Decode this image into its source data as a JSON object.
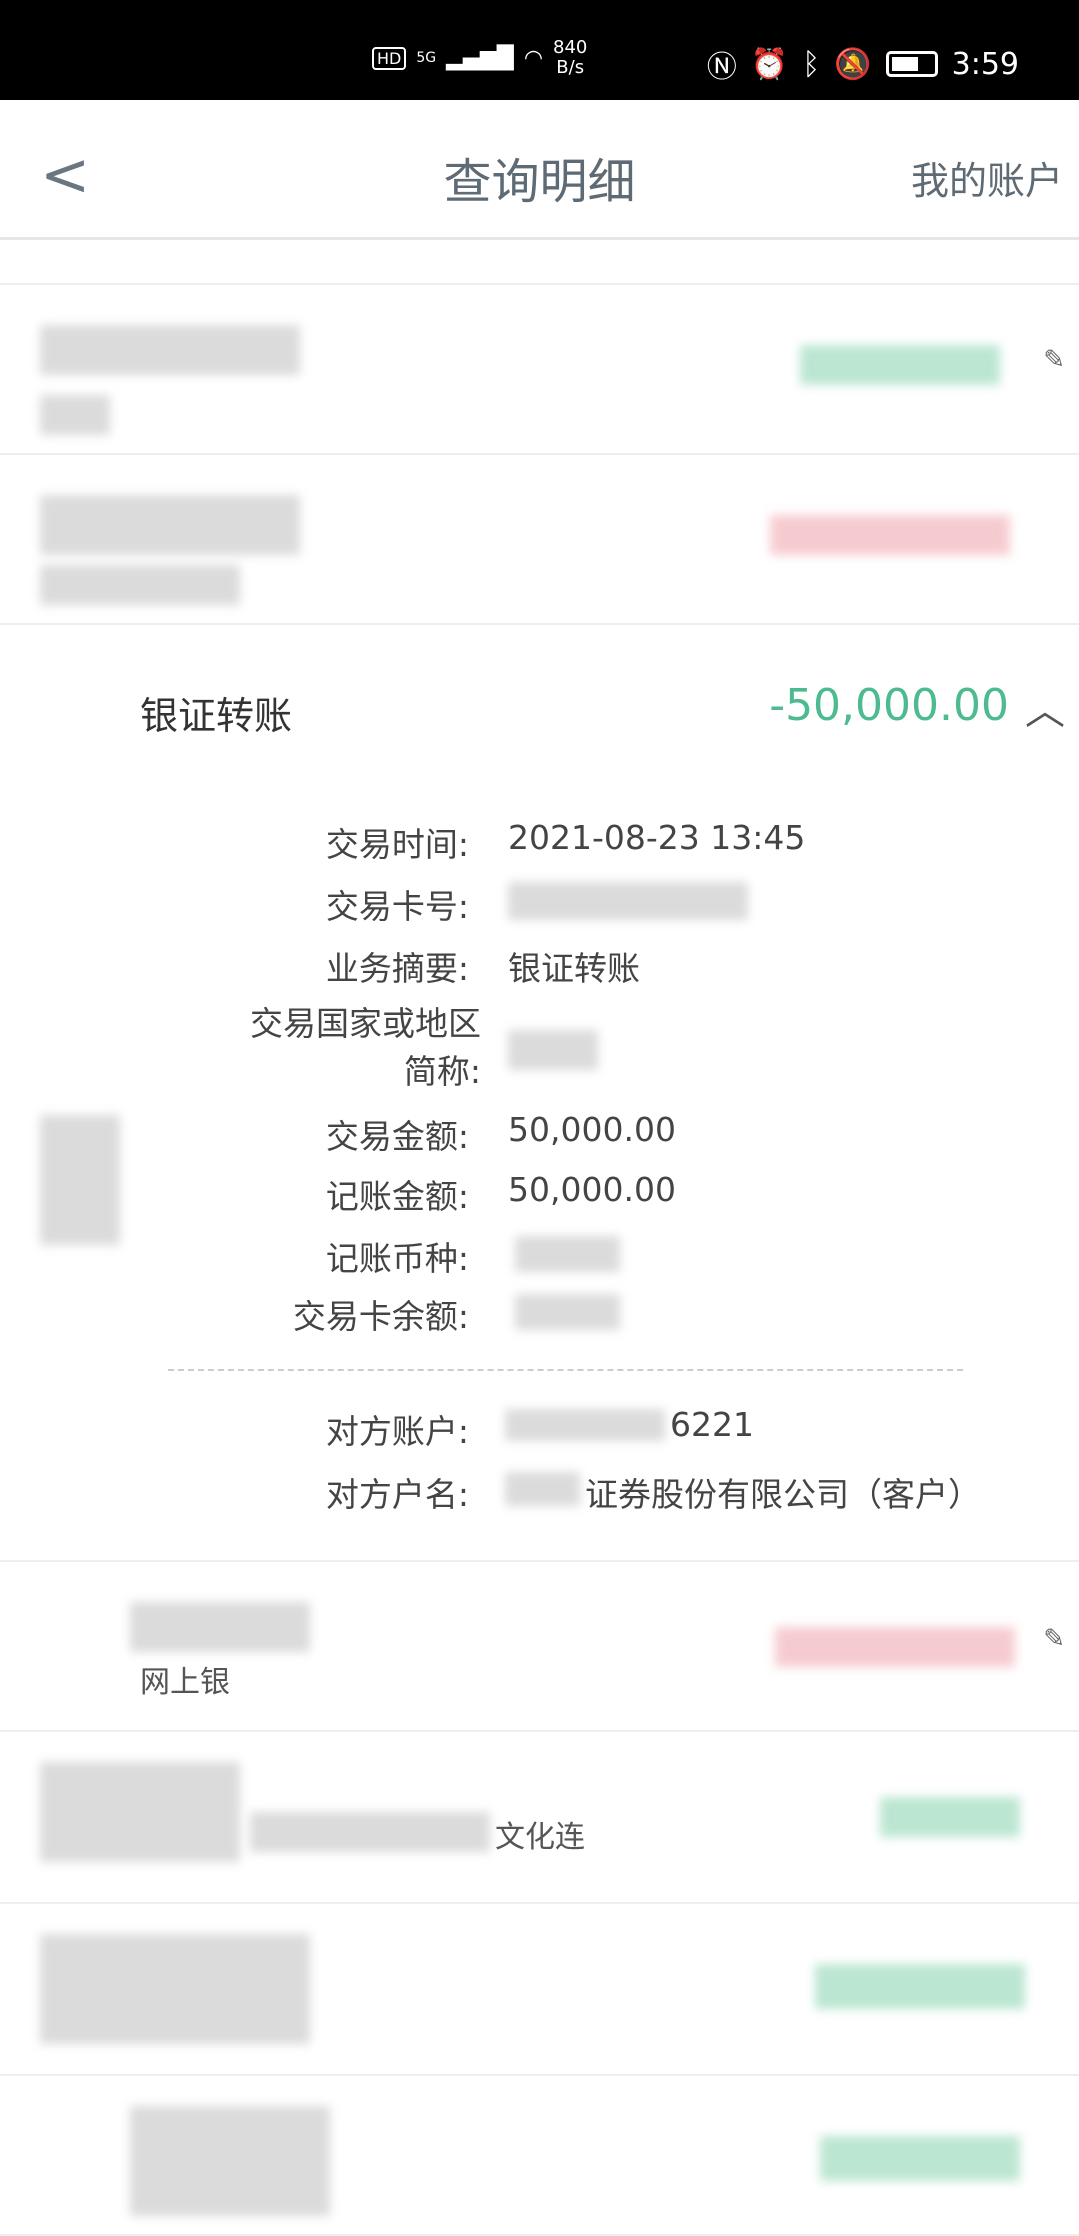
{
  "status_bar": {
    "network": "5G",
    "speed_value": "840",
    "speed_unit": "B/s",
    "time": "3:59"
  },
  "header": {
    "title": "查询明细",
    "right_link": "我的账户"
  },
  "expanded": {
    "title": "银证转账",
    "amount": "-50,000.00",
    "amount_color": "#4dbb8f",
    "fields": [
      {
        "label": "交易时间:",
        "value": "2021-08-23 13:45"
      },
      {
        "label": "交易卡号:",
        "value": ""
      },
      {
        "label": "业务摘要:",
        "value": "银证转账"
      },
      {
        "label": "交易国家或地区简称:",
        "value": ""
      },
      {
        "label": "交易金额:",
        "value": "50,000.00"
      },
      {
        "label": "记账金额:",
        "value": "50,000.00"
      },
      {
        "label": "记账币种:",
        "value": ""
      },
      {
        "label": "交易卡余额:",
        "value": ""
      }
    ],
    "counterparty": [
      {
        "label": "对方账户:",
        "value": "6221"
      },
      {
        "label": "对方户名:",
        "value": "证券股份有限公司（客户）"
      }
    ]
  },
  "rows": [
    {
      "fragment": "网上银"
    },
    {
      "fragment": "文化连"
    }
  ]
}
